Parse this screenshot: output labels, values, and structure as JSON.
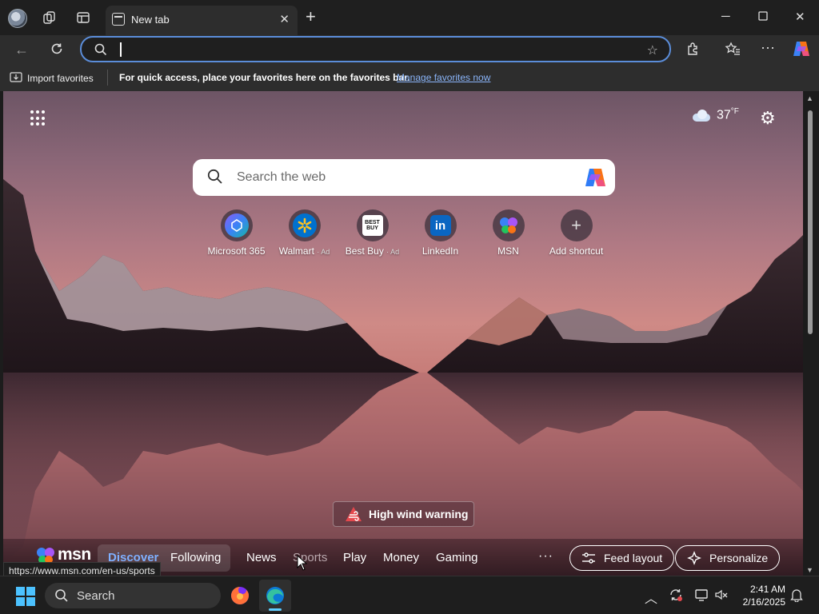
{
  "browser": {
    "tab_title": "New tab",
    "address_value": "",
    "favbar": {
      "import_label": "Import favorites",
      "message": "For quick access, place your favorites here on the favorites bar.",
      "manage_link": "Manage favorites now"
    }
  },
  "newtab": {
    "weather": {
      "temp": "37",
      "unit": "°F"
    },
    "search_placeholder": "Search the web",
    "shortcuts": [
      {
        "label": "Microsoft 365",
        "ad": ""
      },
      {
        "label": "Walmart",
        "ad": "· Ad"
      },
      {
        "label": "Best Buy",
        "ad": "· Ad"
      },
      {
        "label": "LinkedIn",
        "ad": ""
      },
      {
        "label": "MSN",
        "ad": ""
      },
      {
        "label": "Add shortcut",
        "ad": ""
      }
    ],
    "bestbuy_logo_text": "BEST BUY",
    "linkedin_logo_text": "in",
    "wind_warning": "High wind warning",
    "feed": {
      "logo_text": "msn",
      "tabs": [
        "Discover",
        "Following",
        "News",
        "Sports",
        "Play",
        "Money",
        "Gaming"
      ],
      "more": "···",
      "feed_layout": "Feed layout",
      "personalize": "Personalize"
    }
  },
  "status_url": "https://www.msn.com/en-us/sports",
  "taskbar": {
    "search_label": "Search",
    "time": "2:41 AM",
    "date": "2/16/2025"
  }
}
